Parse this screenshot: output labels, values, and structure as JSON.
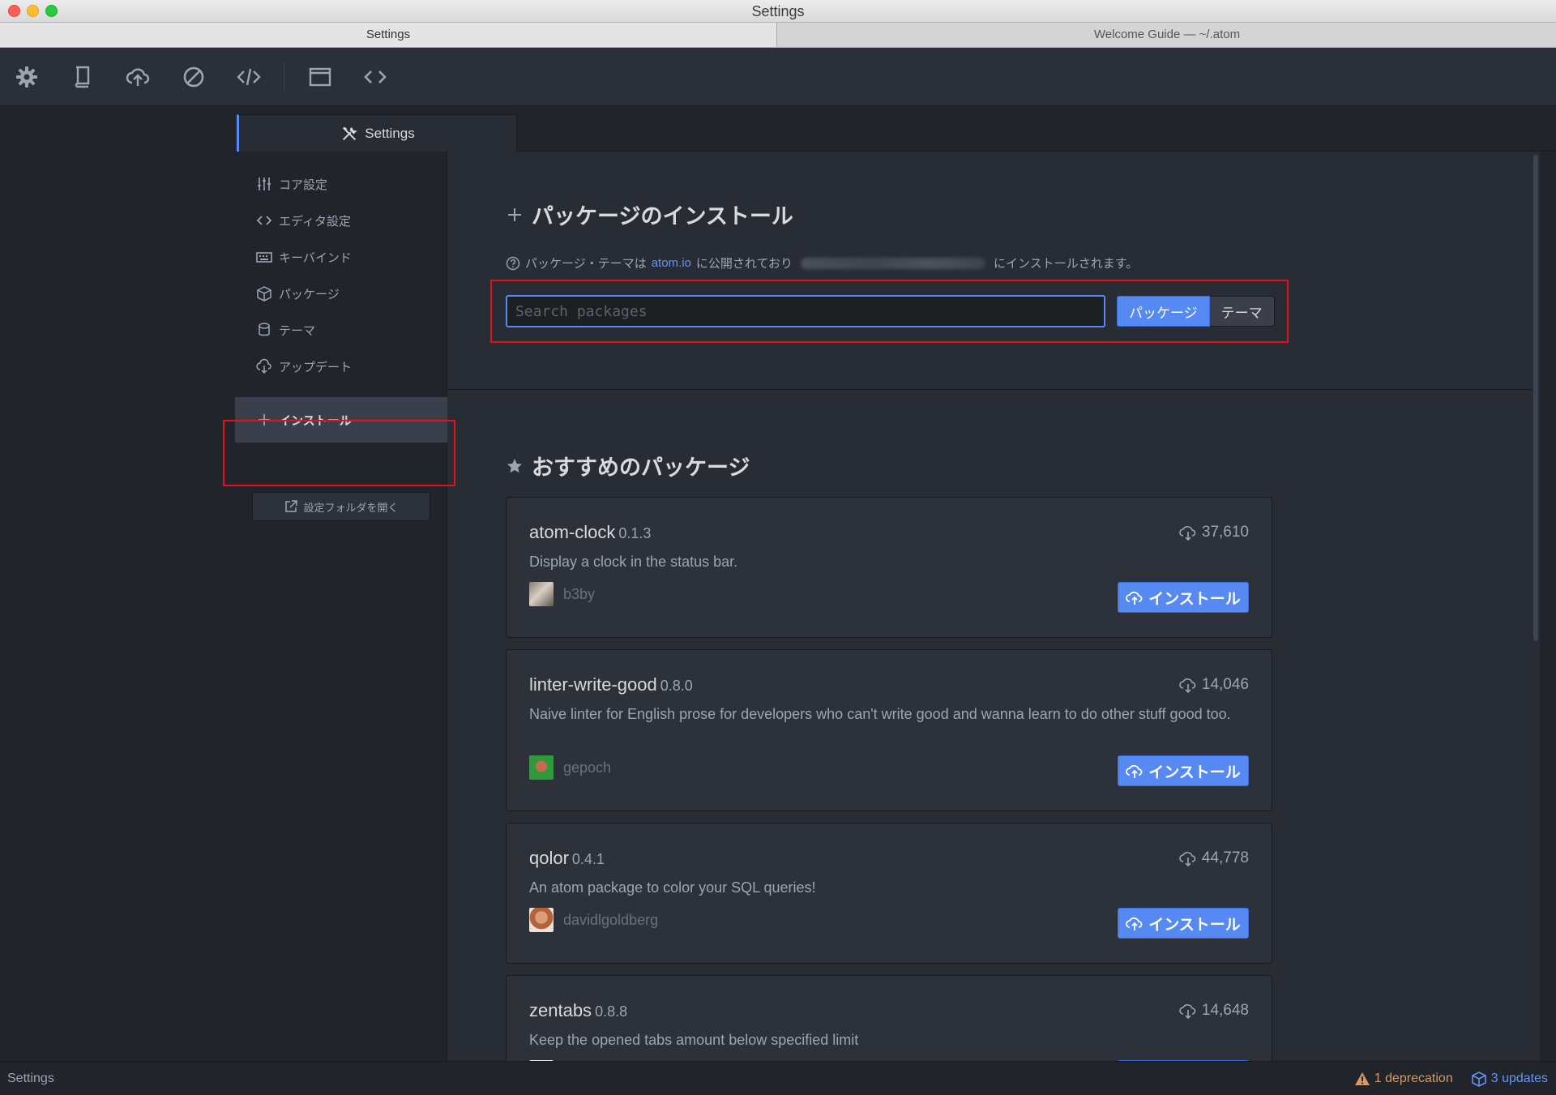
{
  "window": {
    "title": "Settings"
  },
  "tabs": [
    {
      "label": "Settings"
    },
    {
      "label": "Welcome Guide — ~/.atom"
    }
  ],
  "toolbar": {
    "icons": [
      "gear-icon",
      "book-icon",
      "cloud-upload-icon",
      "circle-slash-icon",
      "code-slash-icon",
      "browser-window-icon",
      "code-brackets-icon"
    ]
  },
  "settings_tab": {
    "label": "Settings"
  },
  "nav": {
    "items": [
      {
        "label": "コア設定",
        "icon": "sliders-icon"
      },
      {
        "label": "エディタ設定",
        "icon": "code-icon"
      },
      {
        "label": "キーバインド",
        "icon": "keyboard-icon"
      },
      {
        "label": "パッケージ",
        "icon": "package-icon"
      },
      {
        "label": "テーマ",
        "icon": "paintcan-icon"
      },
      {
        "label": "アップデート",
        "icon": "cloud-download-icon"
      },
      {
        "label": "インストール",
        "icon": "plus-icon",
        "selected": true
      }
    ],
    "open_folder_label": "設定フォルダを開く"
  },
  "install": {
    "heading": "パッケージのインストール",
    "info_prefix": "パッケージ・テーマは",
    "info_link": "atom.io",
    "info_middle": "に公開されており",
    "info_suffix": "にインストールされます。",
    "search_placeholder": "Search packages",
    "search_value": "",
    "toggle_packages": "パッケージ",
    "toggle_themes": "テーマ"
  },
  "featured": {
    "heading": "おすすめのパッケージ",
    "install_label": "インストール",
    "packages": [
      {
        "name": "atom-clock",
        "version": "0.1.3",
        "downloads": "37,610",
        "description": "Display a clock in the status bar.",
        "owner": "b3by"
      },
      {
        "name": "linter-write-good",
        "version": "0.8.0",
        "downloads": "14,046",
        "description": "Naive linter for English prose for developers who can't write good and wanna learn to do other stuff good too.",
        "owner": "gepoch"
      },
      {
        "name": "qolor",
        "version": "0.4.1",
        "downloads": "44,778",
        "description": "An atom package to color your SQL queries!",
        "owner": "davidlgoldberg"
      },
      {
        "name": "zentabs",
        "version": "0.8.8",
        "downloads": "14,648",
        "description": "Keep the opened tabs amount below specified limit",
        "owner": ""
      }
    ]
  },
  "statusbar": {
    "left": "Settings",
    "deprecation": "1 deprecation",
    "updates": "3 updates"
  },
  "colors": {
    "accent": "#568af2",
    "highlight_box": "#e4101c",
    "deprecation": "#d19a66",
    "link": "#6494ed"
  }
}
